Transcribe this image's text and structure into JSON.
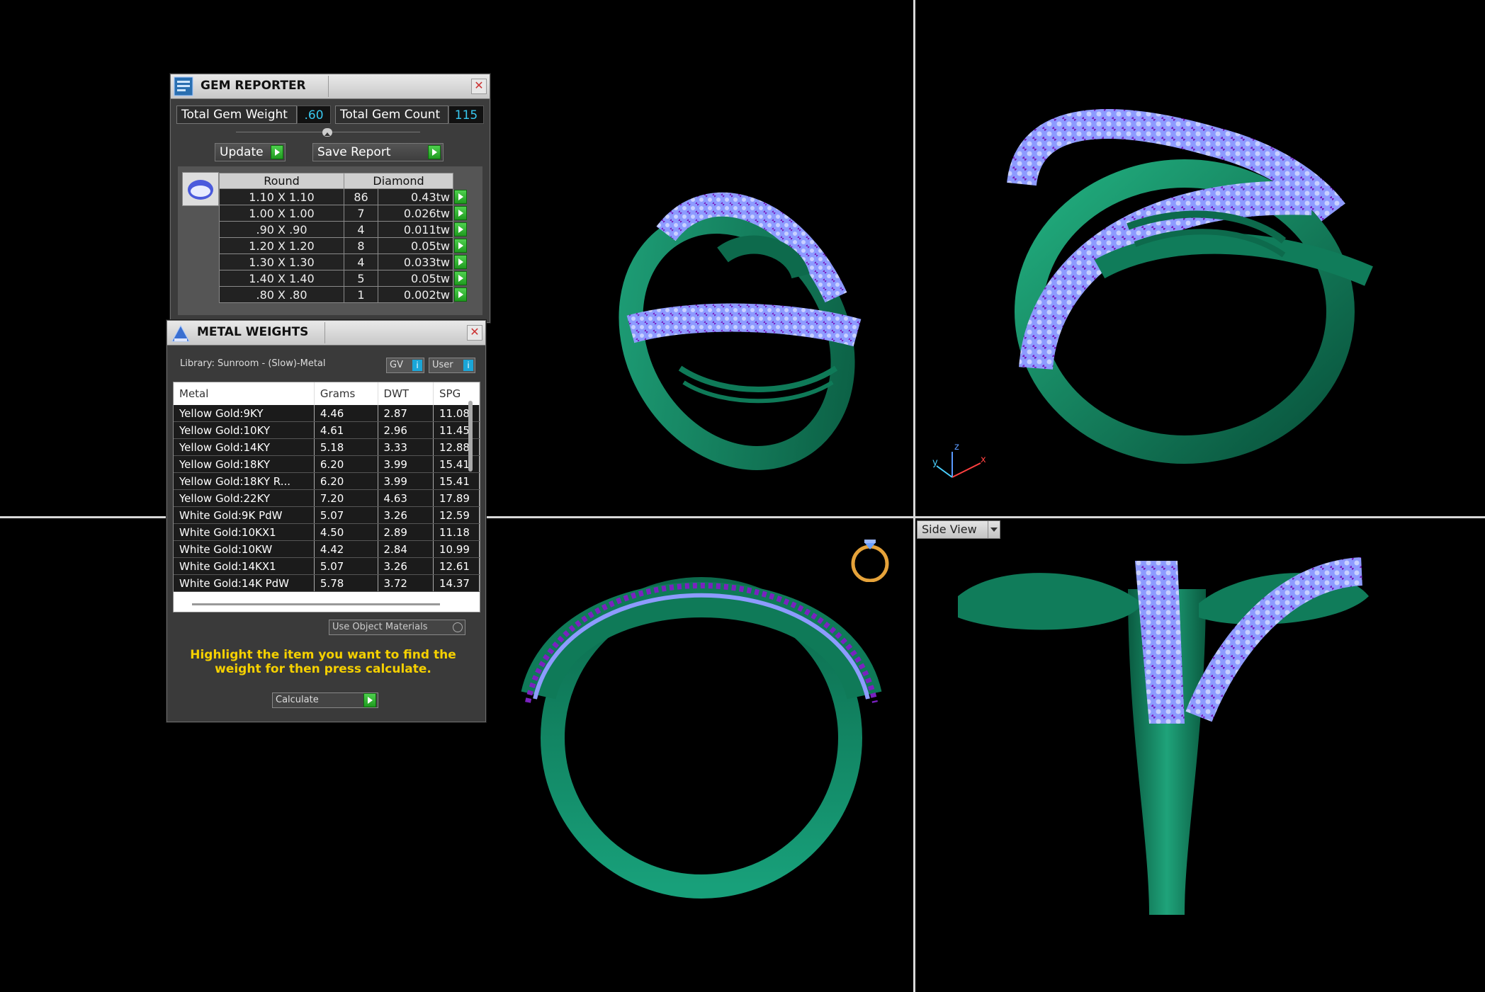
{
  "colors": {
    "accent": "#38c8f0",
    "ring_metal": "#0f7a58",
    "gem": "#9aa8ff",
    "prong": "#8a2bc8",
    "hint": "#f5d000"
  },
  "gem_reporter": {
    "title": "GEM REPORTER",
    "close_icon": "close-icon",
    "total_weight_label": "Total Gem Weight",
    "total_weight_value": ".60",
    "total_count_label": "Total Gem Count",
    "total_count_value": "115",
    "update_label": "Update",
    "save_report_label": "Save Report",
    "shape_header": "Round",
    "material_header": "Diamond",
    "rows": [
      {
        "size": "1.10 X 1.10",
        "count": "86",
        "weight": "0.43tw"
      },
      {
        "size": "1.00 X 1.00",
        "count": "7",
        "weight": "0.026tw"
      },
      {
        "size": ".90 X .90",
        "count": "4",
        "weight": "0.011tw"
      },
      {
        "size": "1.20 X 1.20",
        "count": "8",
        "weight": "0.05tw"
      },
      {
        "size": "1.30 X 1.30",
        "count": "4",
        "weight": "0.033tw"
      },
      {
        "size": "1.40 X 1.40",
        "count": "5",
        "weight": "0.05tw"
      },
      {
        "size": ".80 X .80",
        "count": "1",
        "weight": "0.002tw"
      }
    ]
  },
  "metal_weights": {
    "title": "METAL WEIGHTS",
    "library_label": "Library: Sunroom - (Slow)-Metal",
    "gv_label": "GV",
    "user_label": "User",
    "columns": [
      "Metal",
      "Grams",
      "DWT",
      "SPG"
    ],
    "rows": [
      [
        "Yellow Gold:9KY",
        "4.46",
        "2.87",
        "11.08"
      ],
      [
        "Yellow Gold:10KY",
        "4.61",
        "2.96",
        "11.45"
      ],
      [
        "Yellow Gold:14KY",
        "5.18",
        "3.33",
        "12.88"
      ],
      [
        "Yellow Gold:18KY",
        "6.20",
        "3.99",
        "15.41"
      ],
      [
        "Yellow Gold:18KY R...",
        "6.20",
        "3.99",
        "15.41"
      ],
      [
        "Yellow Gold:22KY",
        "7.20",
        "4.63",
        "17.89"
      ],
      [
        "White Gold:9K PdW",
        "5.07",
        "3.26",
        "12.59"
      ],
      [
        "White Gold:10KX1",
        "4.50",
        "2.89",
        "11.18"
      ],
      [
        "White Gold:10KW",
        "4.42",
        "2.84",
        "10.99"
      ],
      [
        "White Gold:14KX1",
        "5.07",
        "3.26",
        "12.61"
      ],
      [
        "White Gold:14K PdW",
        "5.78",
        "3.72",
        "14.37"
      ]
    ],
    "use_object_materials_label": "Use Object Materials",
    "hint": "Highlight the item you want to find the weight for then press calculate.",
    "calculate_label": "Calculate"
  },
  "viewports": {
    "side_view_label": "Side View",
    "axis_x": "x",
    "axis_y": "y",
    "axis_z": "z"
  }
}
